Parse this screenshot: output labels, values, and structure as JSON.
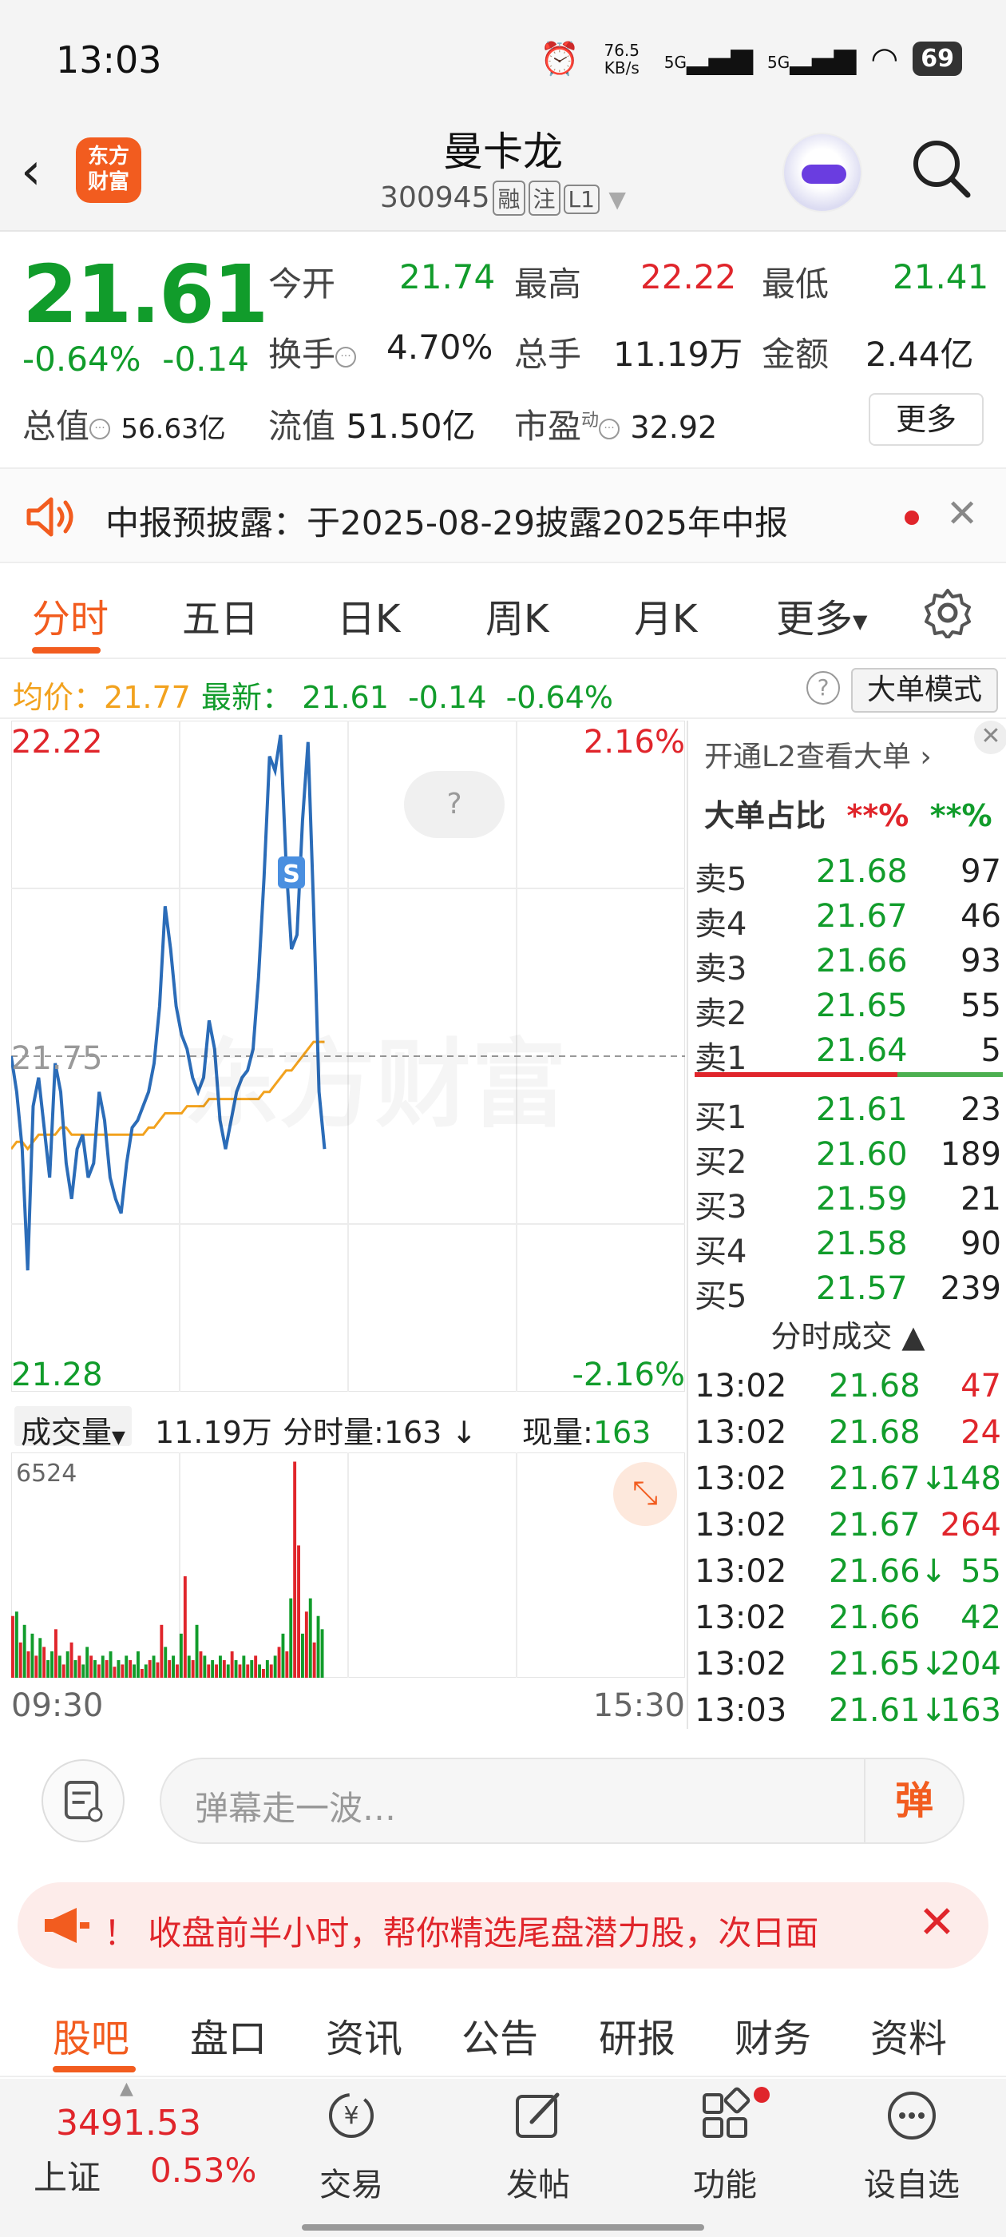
{
  "status": {
    "time": "13:03",
    "net_speed": "76.5 KB/s",
    "sim1": "5G",
    "sim2": "5G",
    "battery": "69"
  },
  "header": {
    "logo_text": "东方财富",
    "title": "曼卡龙",
    "code": "300945",
    "tags": [
      "融",
      "注",
      "L1"
    ]
  },
  "quote": {
    "price": "21.61",
    "change_pct": "-0.64%",
    "change": "-0.14",
    "open_label": "今开",
    "open": "21.74",
    "high_label": "最高",
    "high": "22.22",
    "low_label": "最低",
    "low": "21.41",
    "turnover_label": "换手",
    "turnover": "4.70%",
    "volume_label": "总手",
    "volume": "11.19万",
    "amount_label": "金额",
    "amount": "2.44亿",
    "mktcap_label": "总值",
    "mktcap": "56.63亿",
    "float_label": "流值",
    "float": "51.50亿",
    "pe_label": "市盈",
    "pe_sup": "动",
    "pe": "32.92",
    "more": "更多"
  },
  "notice": {
    "text": "中报预披露：于2025-08-29披露2025年中报"
  },
  "tabs": {
    "items": [
      "分时",
      "五日",
      "日K",
      "周K",
      "月K",
      "更多"
    ]
  },
  "avgrow": {
    "avg_label": "均价：",
    "avg": "21.77",
    "last_label": "最新：",
    "last": "21.61",
    "chg": "-0.14",
    "pct": "-0.64%",
    "mode": "大单模式"
  },
  "chart_data": {
    "type": "line",
    "y_top": "22.22",
    "y_mid": "21.75",
    "y_bottom": "21.28",
    "pct_top": "2.16%",
    "pct_bottom": "-2.16%",
    "ylim": [
      21.28,
      22.22
    ],
    "time_start": "09:30",
    "time_end": "15:30",
    "series": [
      {
        "values": [
          21.75,
          21.7,
          21.62,
          21.45,
          21.68,
          21.72,
          21.65,
          21.58,
          21.74,
          21.7,
          21.6,
          21.55,
          21.62,
          21.64,
          21.58,
          21.6,
          21.7,
          21.66,
          21.58,
          21.55,
          21.53,
          21.6,
          21.65,
          21.66,
          21.68,
          21.7,
          21.74,
          21.82,
          21.96,
          21.9,
          21.82,
          21.78,
          21.76,
          21.72,
          21.7,
          21.72,
          21.8,
          21.76,
          21.66,
          21.62,
          21.66,
          21.7,
          21.72,
          21.73,
          21.76,
          21.86,
          22.0,
          22.17,
          22.15,
          22.2,
          22.02,
          21.9,
          21.92,
          22.08,
          22.19,
          21.96,
          21.7,
          21.62
        ],
        "color": "#2b6cb8"
      },
      {
        "values": [
          21.62,
          21.63,
          21.63,
          21.62,
          21.63,
          21.64,
          21.64,
          21.64,
          21.64,
          21.65,
          21.65,
          21.64,
          21.64,
          21.64,
          21.64,
          21.64,
          21.64,
          21.64,
          21.64,
          21.64,
          21.64,
          21.64,
          21.64,
          21.64,
          21.64,
          21.65,
          21.65,
          21.66,
          21.67,
          21.67,
          21.67,
          21.67,
          21.68,
          21.68,
          21.68,
          21.68,
          21.69,
          21.69,
          21.69,
          21.69,
          21.69,
          21.69,
          21.69,
          21.69,
          21.69,
          21.69,
          21.7,
          21.7,
          21.71,
          21.72,
          21.73,
          21.73,
          21.74,
          21.75,
          21.76,
          21.77,
          21.77,
          21.77
        ],
        "color": "#f2a21e"
      }
    ],
    "volume": {
      "max_label": "6524",
      "total_label": "成交量",
      "total": "11.19万",
      "minute_label": "分时量:",
      "minute": "163",
      "now_label": "现量:",
      "now": "163",
      "bars": [
        0.28,
        0.3,
        0.16,
        0.24,
        0.12,
        0.2,
        0.1,
        0.18,
        0.14,
        0.08,
        0.12,
        0.22,
        0.1,
        0.06,
        0.12,
        0.16,
        0.08,
        0.1,
        0.06,
        0.14,
        0.1,
        0.08,
        0.06,
        0.1,
        0.08,
        0.12,
        0.05,
        0.08,
        0.06,
        0.1,
        0.08,
        0.06,
        0.12,
        0.04,
        0.06,
        0.08,
        0.1,
        0.07,
        0.24,
        0.14,
        0.08,
        0.1,
        0.06,
        0.2,
        0.46,
        0.1,
        0.08,
        0.24,
        0.12,
        0.1,
        0.06,
        0.08,
        0.06,
        0.1,
        0.08,
        0.06,
        0.12,
        0.08,
        0.06,
        0.1,
        0.06,
        0.08,
        0.1,
        0.06,
        0.04,
        0.08,
        0.06,
        0.1,
        0.14,
        0.2,
        0.12,
        0.36,
        0.98,
        0.6,
        0.2,
        0.3,
        0.36,
        0.16,
        0.28,
        0.22
      ],
      "bar_colors": [
        "r",
        "g",
        "r",
        "g",
        "r",
        "g",
        "r",
        "g",
        "r",
        "g",
        "g",
        "r",
        "g",
        "r",
        "g",
        "r",
        "g",
        "r",
        "g",
        "g",
        "r",
        "g",
        "r",
        "g",
        "r",
        "g",
        "r",
        "g",
        "r",
        "g",
        "r",
        "g",
        "g",
        "r",
        "g",
        "r",
        "g",
        "r",
        "r",
        "g",
        "r",
        "g",
        "r",
        "g",
        "r",
        "g",
        "r",
        "g",
        "r",
        "g",
        "r",
        "g",
        "r",
        "g",
        "r",
        "g",
        "r",
        "g",
        "r",
        "g",
        "r",
        "g",
        "r",
        "g",
        "r",
        "g",
        "r",
        "g",
        "r",
        "g",
        "r",
        "g",
        "r",
        "r",
        "g",
        "r",
        "g",
        "r",
        "g",
        "g"
      ]
    }
  },
  "orderbook": {
    "l2_text": "开通L2查看大单 ›",
    "big_ratio_label": "大单占比",
    "big_ratio_red": "**%",
    "big_ratio_green": "**%",
    "asks": [
      {
        "name": "卖5",
        "price": "21.68",
        "qty": "97"
      },
      {
        "name": "卖4",
        "price": "21.67",
        "qty": "46"
      },
      {
        "name": "卖3",
        "price": "21.66",
        "qty": "93"
      },
      {
        "name": "卖2",
        "price": "21.65",
        "qty": "55"
      },
      {
        "name": "卖1",
        "price": "21.64",
        "qty": "5"
      }
    ],
    "bids": [
      {
        "name": "买1",
        "price": "21.61",
        "qty": "23"
      },
      {
        "name": "买2",
        "price": "21.60",
        "qty": "189"
      },
      {
        "name": "买3",
        "price": "21.59",
        "qty": "21"
      },
      {
        "name": "买4",
        "price": "21.58",
        "qty": "90"
      },
      {
        "name": "买5",
        "price": "21.57",
        "qty": "239"
      }
    ],
    "ts_title": "分时成交 ▲",
    "trades": [
      {
        "t": "13:02",
        "p": "21.68",
        "arrow": "",
        "q": "47",
        "c": "red"
      },
      {
        "t": "13:02",
        "p": "21.68",
        "arrow": "",
        "q": "24",
        "c": "red"
      },
      {
        "t": "13:02",
        "p": "21.67",
        "arrow": "↓",
        "q": "148",
        "c": "green"
      },
      {
        "t": "13:02",
        "p": "21.67",
        "arrow": "",
        "q": "264",
        "c": "red"
      },
      {
        "t": "13:02",
        "p": "21.66",
        "arrow": "↓",
        "q": "55",
        "c": "green"
      },
      {
        "t": "13:02",
        "p": "21.66",
        "arrow": "",
        "q": "42",
        "c": "green"
      },
      {
        "t": "13:02",
        "p": "21.65",
        "arrow": "↓",
        "q": "204",
        "c": "green"
      },
      {
        "t": "13:03",
        "p": "21.61",
        "arrow": "↓",
        "q": "163",
        "c": "green"
      }
    ]
  },
  "comment": {
    "placeholder": "弹幕走一波…",
    "danmu": "弹"
  },
  "promo": {
    "text": "！ 收盘前半小时，帮你精选尾盘潜力股，次日面"
  },
  "bottom_tabs": [
    "股吧",
    "盘口",
    "资讯",
    "公告",
    "研报",
    "财务",
    "资料"
  ],
  "nav": {
    "index_value": "3491.53",
    "index_name": "上证",
    "index_pct": "0.53%",
    "items": [
      {
        "label": "交易",
        "icon": "trade-icon"
      },
      {
        "label": "发帖",
        "icon": "post-icon"
      },
      {
        "label": "功能",
        "icon": "apps-icon"
      },
      {
        "label": "设自选",
        "icon": "more-icon"
      }
    ]
  },
  "colors": {
    "red": "#e0252b",
    "green": "#119c2b",
    "accent": "#f25c1f",
    "price_line": "#2b6cb8",
    "avg_line": "#f2a21e"
  }
}
